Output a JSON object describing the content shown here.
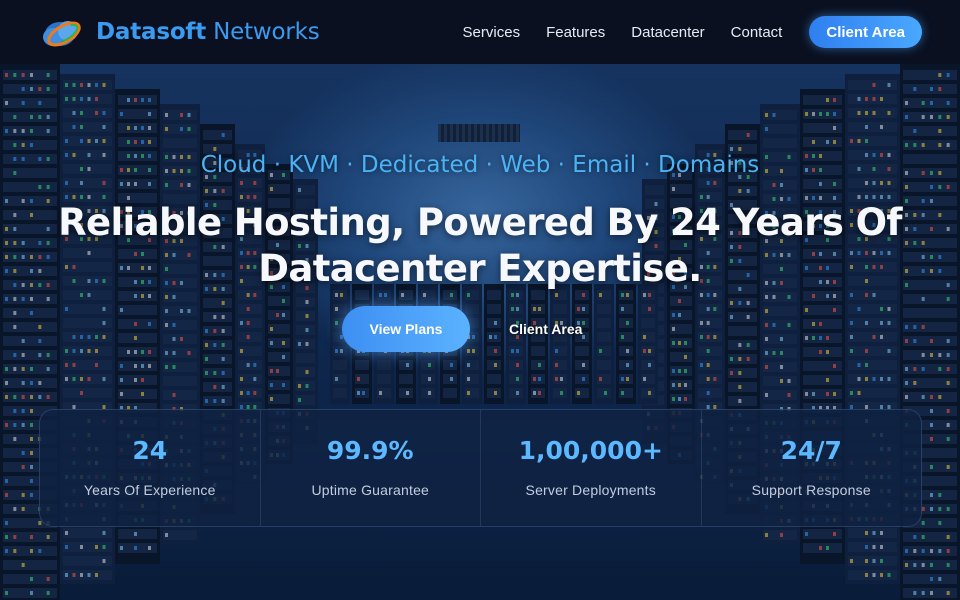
{
  "brand": {
    "name_strong": "Datasoft",
    "name_light": " Networks",
    "logo_icon": "globe-cloud-icon"
  },
  "nav": {
    "items": [
      {
        "label": "Services"
      },
      {
        "label": "Features"
      },
      {
        "label": "Datacenter"
      },
      {
        "label": "Contact"
      }
    ],
    "client_area_label": "Client Area"
  },
  "hero": {
    "tagline": "Cloud · KVM · Dedicated · Web · Email · Domains",
    "headline_line1": "Reliable Hosting, Powered By 24 Years Of",
    "headline_line2": "Datacenter Expertise.",
    "primary_cta": "View Plans",
    "secondary_cta": "Client Area"
  },
  "stats": [
    {
      "value": "24",
      "label": "Years Of Experience"
    },
    {
      "value": "99.9%",
      "label": "Uptime Guarantee"
    },
    {
      "value": "1,00,000+",
      "label": "Server Deployments"
    },
    {
      "value": "24/7",
      "label": "Support Response"
    }
  ],
  "colors": {
    "accent": "#3a9bf0",
    "header_bg": "#0a1020",
    "stat_value": "#5cb8ff",
    "tagline": "#4ab3f5"
  }
}
